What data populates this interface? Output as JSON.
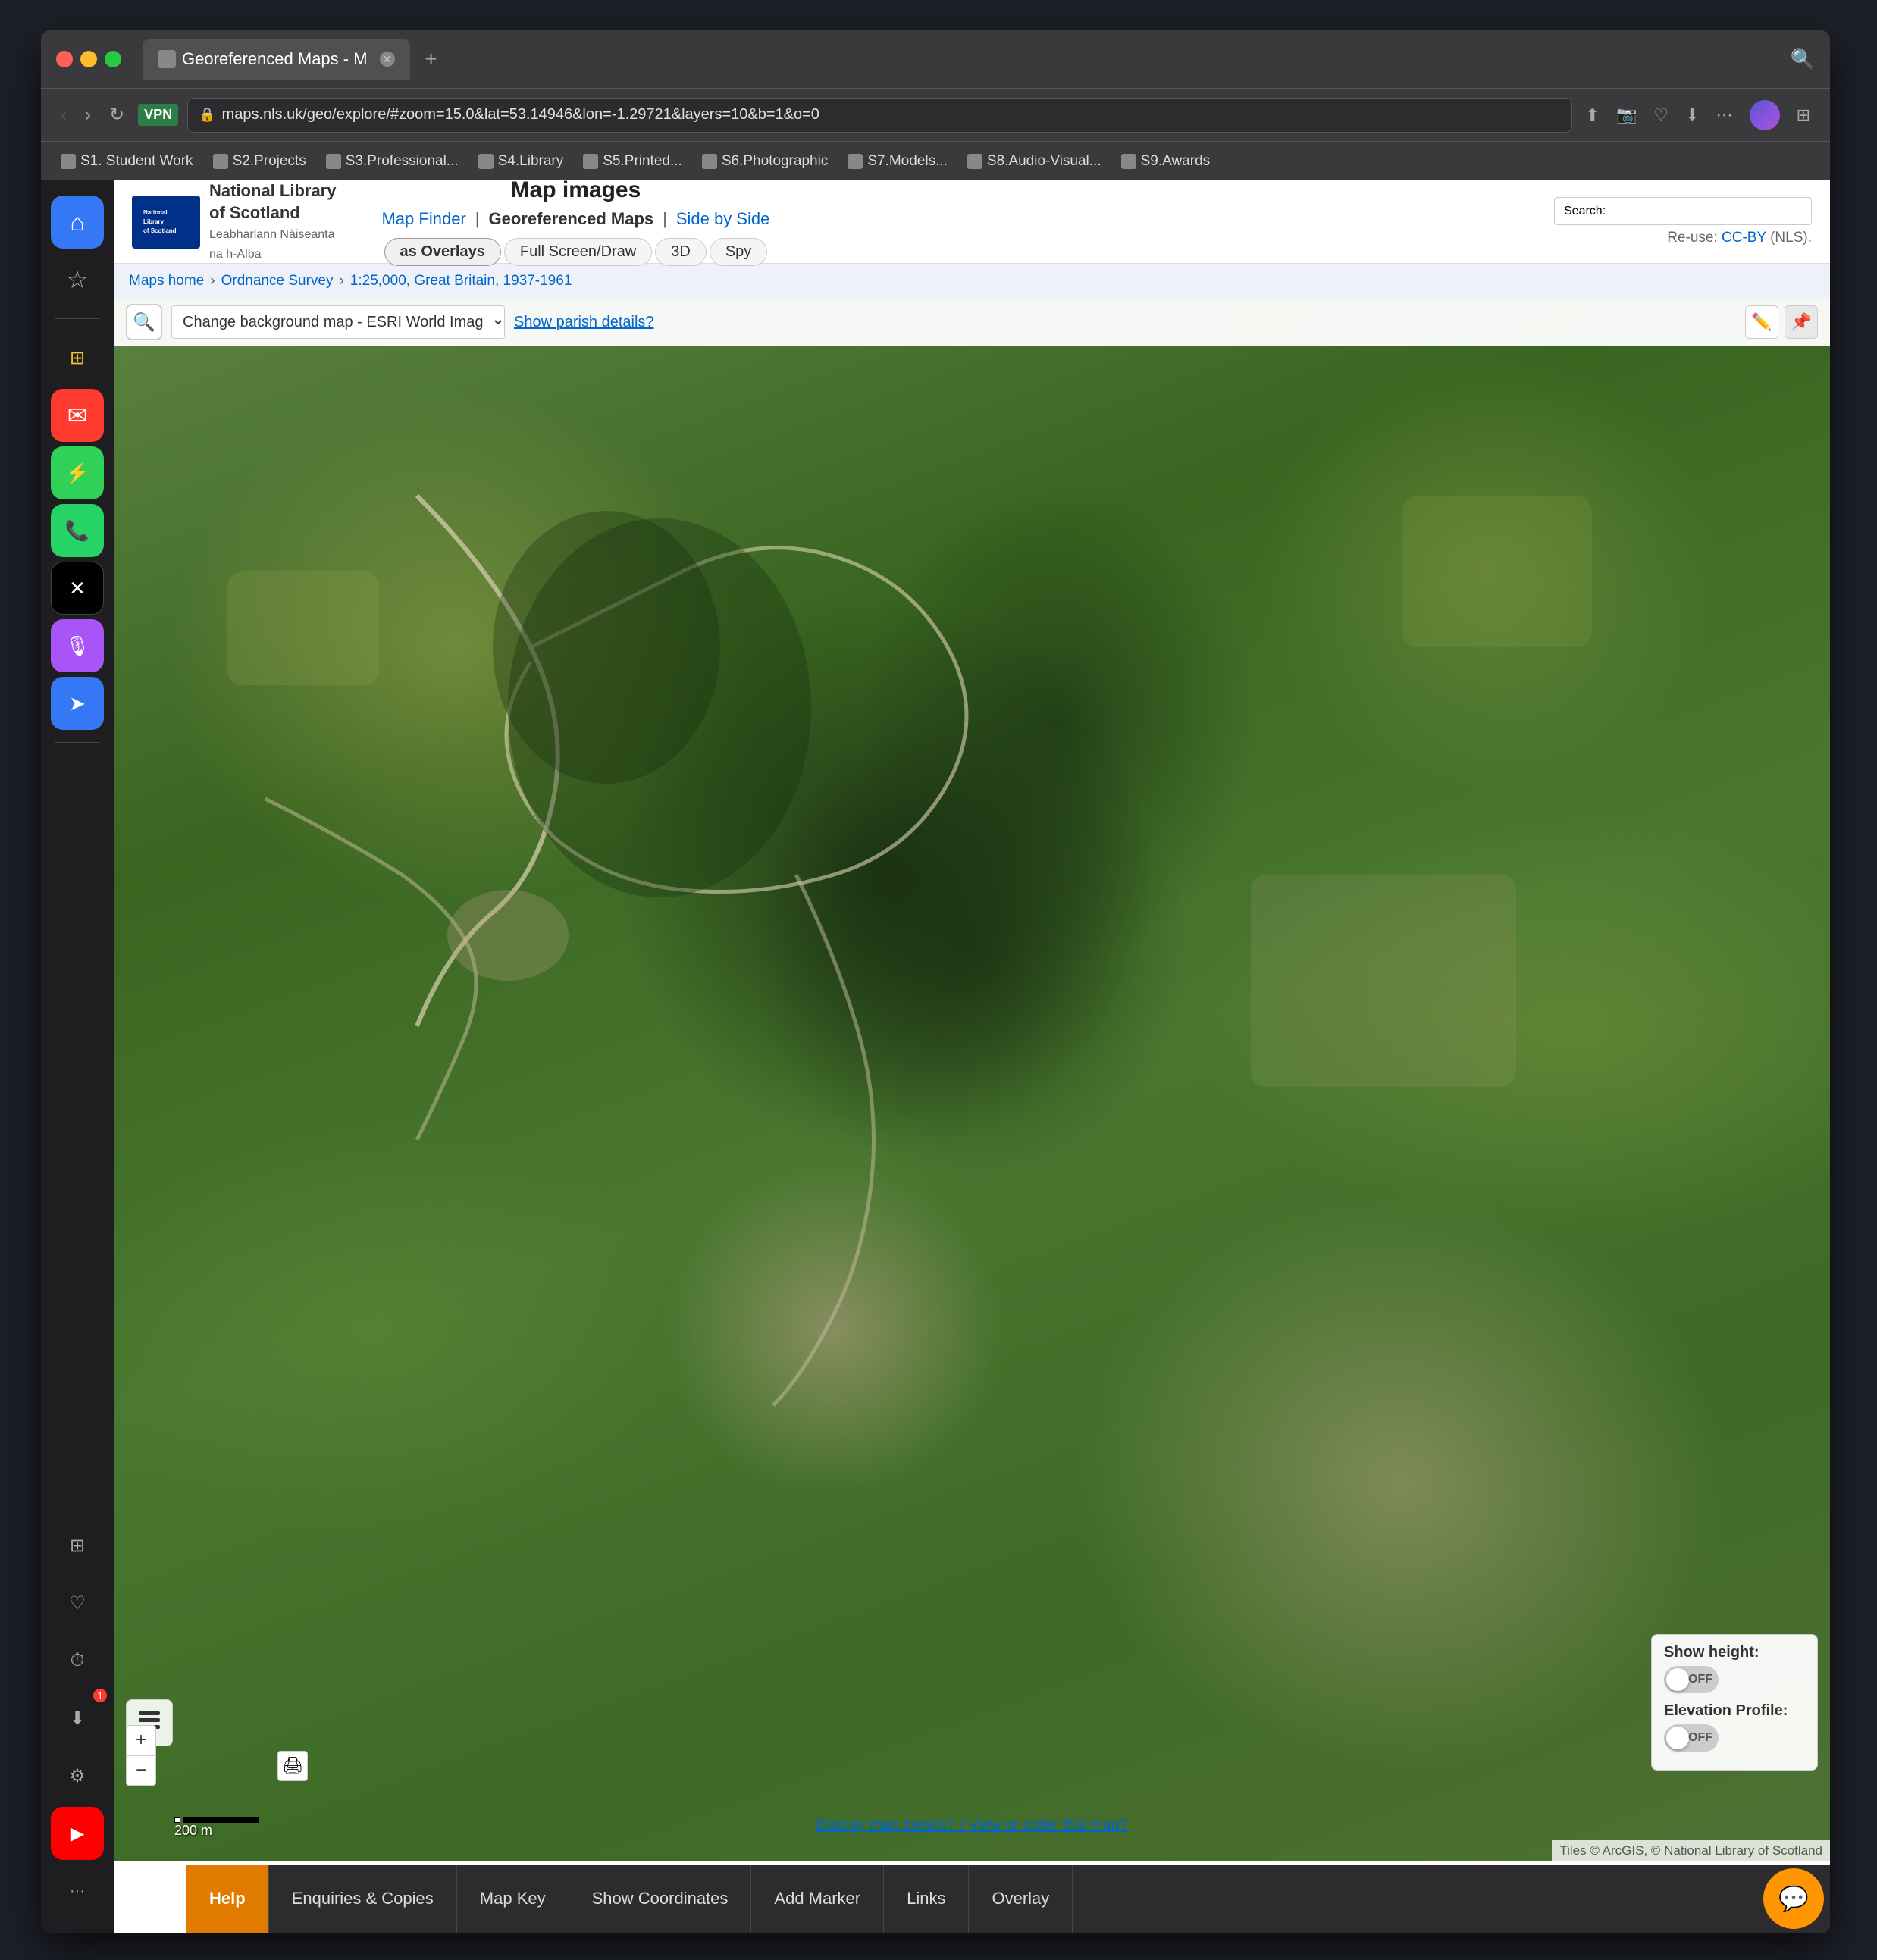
{
  "window": {
    "title": "Georeferenced Maps - M"
  },
  "titlebar": {
    "tab_label": "Georeferenced Maps - M",
    "new_tab": "+",
    "search_icon": "🔍"
  },
  "navbar": {
    "back": "‹",
    "forward": "›",
    "reload": "↻",
    "vpn": "VPN",
    "url": "maps.nls.uk/geo/explore/#zoom=15.0&lat=53.14946&lon=-1.29721&layers=10&b=1&o=0",
    "share_icon": "⬆",
    "camera_icon": "📷",
    "bookmark_icon": "♡",
    "download_icon": "⬇",
    "menu_icon": "⋯",
    "extensions_icon": "⚙",
    "profile_icon": "👤"
  },
  "bookmarks": [
    {
      "label": "S1. Student Work"
    },
    {
      "label": "S2.Projects"
    },
    {
      "label": "S3.Professional..."
    },
    {
      "label": "S4.Library"
    },
    {
      "label": "S5.Printed..."
    },
    {
      "label": "S6.Photographic"
    },
    {
      "label": "S7.Models..."
    },
    {
      "label": "S8.Audio-Visual..."
    },
    {
      "label": "S9.Awards"
    }
  ],
  "sidebar": {
    "icons": [
      {
        "name": "home",
        "symbol": "⌂",
        "class": "home"
      },
      {
        "name": "star",
        "symbol": "☆",
        "class": "star"
      },
      {
        "name": "apps",
        "symbol": "⊞",
        "class": "apps"
      },
      {
        "name": "mail",
        "symbol": "✉",
        "class": "mail"
      },
      {
        "name": "messenger",
        "symbol": "⚡",
        "class": "msg"
      },
      {
        "name": "whatsapp",
        "symbol": "📱",
        "class": "whatsapp"
      },
      {
        "name": "twitter",
        "symbol": "✕",
        "class": "twitter"
      },
      {
        "name": "podcast",
        "symbol": "🎙",
        "class": "podcast"
      },
      {
        "name": "prompt",
        "symbol": "➤",
        "class": "prompt"
      }
    ],
    "bottom_icons": [
      {
        "name": "grid",
        "symbol": "⊞"
      },
      {
        "name": "heart",
        "symbol": "♡"
      },
      {
        "name": "clock",
        "symbol": "⏱"
      },
      {
        "name": "download",
        "symbol": "⬇"
      },
      {
        "name": "settings",
        "symbol": "⚙"
      },
      {
        "name": "youtube",
        "symbol": "▶"
      },
      {
        "name": "more",
        "symbol": "···"
      }
    ]
  },
  "site": {
    "logo_text": "National Library of Scotland",
    "logo_subtitle": "Leabharlann Nàiseanta na h-Alba",
    "header_title": "Map images",
    "nav_links": {
      "map_finder": "Map Finder",
      "separator1": "|",
      "georef_maps": "Georeferenced Maps",
      "separator2": "|",
      "side_by_side": "Side by Side"
    },
    "nav_buttons": {
      "as_overlays": "as Overlays",
      "full_screen": "Full Screen/Draw",
      "three_d": "3D",
      "spy": "Spy"
    },
    "search_label": "Search:",
    "search_placeholder": "",
    "reuse_text": "Re-use:",
    "cc_by": "CC-BY",
    "cc_suffix": "(NLS)."
  },
  "breadcrumb": {
    "maps_home": "Maps home",
    "sep1": "›",
    "ordnance_survey": "Ordnance Survey",
    "sep2": "›",
    "map_name": "1:25,000, Great Britain, 1937-1961"
  },
  "map": {
    "bg_select_value": "Change background map - ESRI World Image",
    "parish_btn": "Show parish details?",
    "zoom_in": "+",
    "zoom_out": "−",
    "scale_label": "200 m",
    "info_link": "Display map details? / View or order this map?",
    "attribution": "Tiles © ArcGIS, © National Library of Scotland",
    "edit_icon": "✏",
    "pin_icon": "📍",
    "search_icon": "🔍",
    "layer_icon": "⊞",
    "print_icon": "🖨"
  },
  "height_panel": {
    "height_label": "Show height:",
    "height_toggle": "OFF",
    "elevation_label": "Elevation Profile:",
    "elevation_toggle": "OFF"
  },
  "bottom_toolbar": {
    "help": "Help",
    "enquiries": "Enquiries & Copies",
    "map_key": "Map Key",
    "show_coordinates": "Show Coordinates",
    "add_marker": "Add Marker",
    "links": "Links",
    "overlay": "Overlay",
    "chat_icon": "💬"
  }
}
